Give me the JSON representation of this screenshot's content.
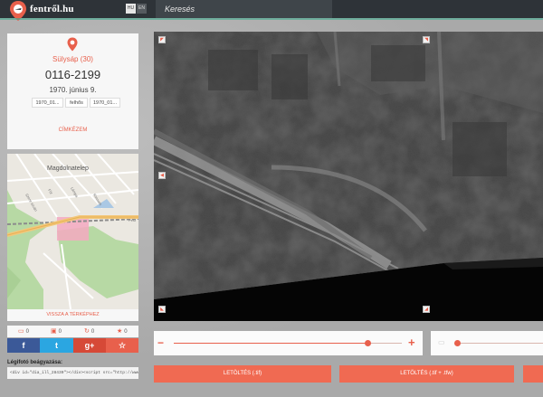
{
  "topbar": {
    "logo_text": "fentről.hu",
    "lang_hu": "HU",
    "lang_en": "EN",
    "search_label": "Keresés"
  },
  "info_card": {
    "area_name": "Sülysáp (30)",
    "photo_id": "0116-2199",
    "date": "1970. június 9.",
    "tags": [
      "1970_01...",
      "felhős",
      "1970_01..."
    ],
    "tags_button": "CÍMKÉZEM"
  },
  "minimap": {
    "place_label": "Magdolnatelep",
    "street_labels": [
      "Szent István",
      "Fót",
      "Lámpa",
      "Pest",
      "Kossuth"
    ],
    "back_button": "VISSZA A TÉRKÉPHEZ"
  },
  "stats": {
    "comments": "0",
    "photos": "0",
    "views": "0",
    "favorites": "0"
  },
  "share": {
    "facebook": "f",
    "twitter": "t",
    "googleplus": "g+",
    "favorite": "☆"
  },
  "embed": {
    "label": "Légifotó beágyazása:",
    "code": "<div id=\"dia_ill_28430\"></div><script src=\"http://www.fentrol"
  },
  "viewer": {
    "corner_icons": [
      "arrow-top-left-icon",
      "arrow-top-right-icon",
      "arrow-left-icon",
      "arrow-bottom-left-icon",
      "arrow-bottom-right-icon"
    ]
  },
  "zoom": {
    "minus": "−",
    "plus": "+",
    "level": 0.85
  },
  "opacity": {
    "level": 0.0
  },
  "downloads": {
    "tif": "LETÖLTÉS (.tif)",
    "tif_tfw": "LETÖLTÉS (.tif + .tfw)"
  },
  "colors": {
    "accent": "#e8604c",
    "topbar": "#2e3338",
    "facebook": "#3b5998",
    "twitter": "#2ba6e1",
    "googleplus": "#d64937"
  }
}
